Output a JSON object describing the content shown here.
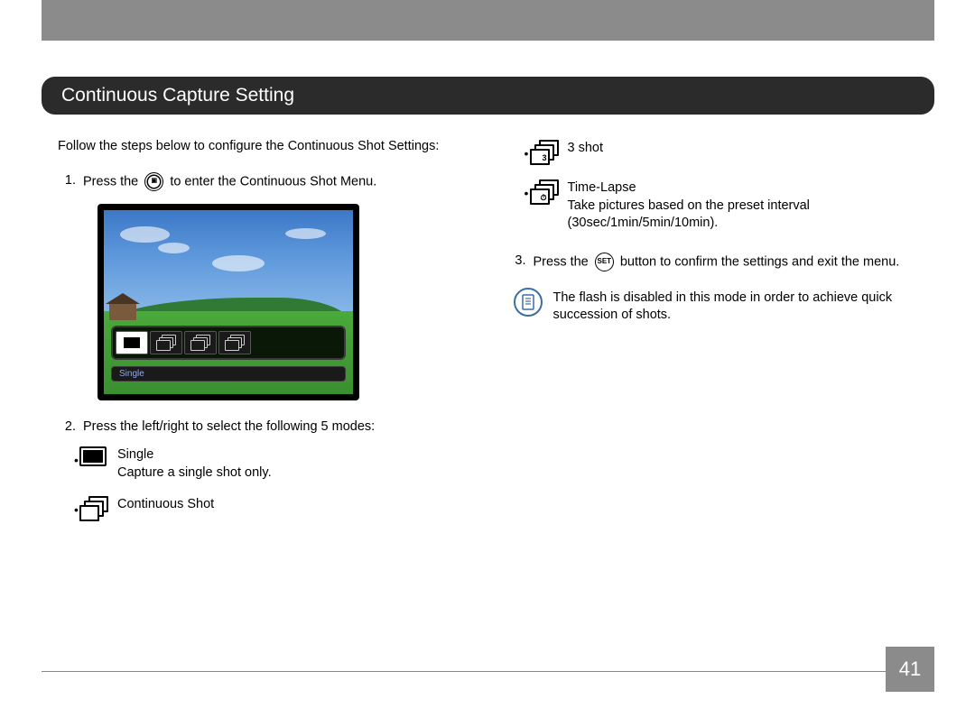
{
  "section_title": "Continuous Capture Setting",
  "intro": "Follow the steps below to configure the Continuous Shot Settings:",
  "step1_pre": "Press the",
  "step1_post": "to enter the Continuous Shot Menu.",
  "lcd_label": "Single",
  "step2": "Press the left/right to select the following 5 modes:",
  "modes": {
    "single": {
      "label": "Single",
      "desc": "Capture a single shot only."
    },
    "continuous": {
      "label": "Continuous Shot"
    },
    "three_shot": {
      "label": "3 shot"
    },
    "timelapse": {
      "label": "Time-Lapse",
      "desc": "Take pictures based on the preset interval (30sec/1min/5min/10min)."
    }
  },
  "step3_pre": "Press the",
  "step3_btn": "SET",
  "step3_post": "button to confirm the settings and exit the menu.",
  "note": "The flash is disabled in this mode in order to achieve quick succession of shots.",
  "page_number": "41",
  "step_numbers": {
    "s1": "1.",
    "s2": "2.",
    "s3": "3."
  }
}
